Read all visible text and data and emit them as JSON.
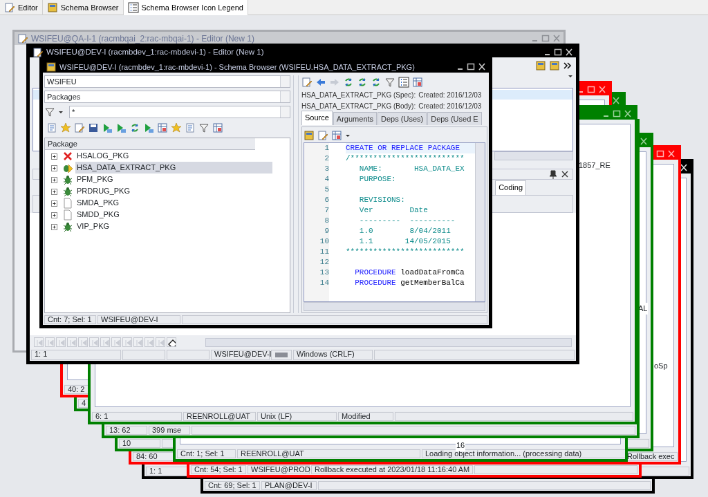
{
  "doc_tabs": [
    {
      "label": "Editor",
      "selected": false
    },
    {
      "label": "Schema Browser",
      "selected": false
    },
    {
      "label": "Schema Browser Icon Legend",
      "selected": true
    }
  ],
  "back_windows": [
    {
      "color": "#000000",
      "status": [
        "Cnt: 69; Sel: 1",
        "PLAN@DEV-I"
      ]
    },
    {
      "color": "#000000",
      "status": [
        "1:  1"
      ]
    },
    {
      "color": "#ff0000",
      "status": [
        "Cnt: 54; Sel: 1",
        "WSIFEU@PROD",
        "Rollback executed at 2023/01/18 11:16:40 AM"
      ]
    },
    {
      "color": "#ff0000",
      "status": [
        "84: 60",
        "Rollback exec"
      ],
      "fragments": [
        "oSp"
      ]
    },
    {
      "color": "#008000",
      "status": [
        "10"
      ],
      "fragments": [
        "AL"
      ]
    },
    {
      "color": "#008000",
      "status": [
        "Cnt: 1; Sel: 1",
        "REENROLL@UAT",
        "Loading object information... (processing data)"
      ],
      "fragments": [
        "16"
      ]
    },
    {
      "color": "#008000",
      "status": [
        "13: 62",
        "399 mse"
      ]
    },
    {
      "color": "#ff0000",
      "status": [
        "40: 2"
      ]
    },
    {
      "color": "#008000",
      "status": [
        "4"
      ]
    },
    {
      "color": "#008000",
      "status": [
        "6:  1",
        "REENROLL@UAT",
        "Unix (LF)",
        "Modified"
      ],
      "fragments": [
        "1857_RE"
      ]
    }
  ],
  "qa_editor": {
    "title": "WSIFEU@QA-I-1 (racmbqai_2:rac-mbqai-1) - Editor (New 1)"
  },
  "dev_editor": {
    "title": "WSIFEU@DEV-I (racmbdev_1:rac-mbdevi-1) - Editor (New 1)",
    "tab": "Coding",
    "status": [
      "1:  1",
      "WSIFEU@DEV-I",
      "Windows (CRLF)"
    ]
  },
  "schema_browser": {
    "title": "WSIFEU@DEV-I (racmbdev_1:rac-mbdevi-1) - Schema Browser (WSIFEU.HSA_DATA_EXTRACT_PKG)",
    "schema": "WSIFEU",
    "object_type": "Packages",
    "filter": "*",
    "tree_header": "Package",
    "packages": [
      {
        "name": "HSALOG_PKG",
        "kind": "invalid",
        "selected": false
      },
      {
        "name": "HSA_DATA_EXTRACT_PKG",
        "kind": "debug",
        "selected": true
      },
      {
        "name": "PFM_PKG",
        "kind": "bug",
        "selected": false
      },
      {
        "name": "PRDRUG_PKG",
        "kind": "bug",
        "selected": false
      },
      {
        "name": "SMDA_PKG",
        "kind": "plain",
        "selected": false
      },
      {
        "name": "SMDD_PKG",
        "kind": "plain",
        "selected": false
      },
      {
        "name": "VIP_PKG",
        "kind": "bug",
        "selected": false
      }
    ],
    "status": [
      "Cnt: 7; Sel: 1",
      "WSIFEU@DEV-I"
    ],
    "info": [
      {
        "object": "HSA_DATA_EXTRACT_PKG (Spec):",
        "created": "Created: 2016/12/03"
      },
      {
        "object": "HSA_DATA_EXTRACT_PKG (Body):",
        "created": "Created: 2016/12/03"
      }
    ],
    "tabs": [
      {
        "label": "Source",
        "selected": true
      },
      {
        "label": "Arguments",
        "selected": false
      },
      {
        "label": "Deps (Uses)",
        "selected": false
      },
      {
        "label": "Deps (Used E",
        "selected": false
      }
    ],
    "code": [
      {
        "no": "1",
        "segments": [
          {
            "text": "CREATE OR REPLACE PACKAGE",
            "kind": "keyword"
          }
        ]
      },
      {
        "no": "2",
        "segments": [
          {
            "text": "/*************************",
            "kind": "comment"
          }
        ]
      },
      {
        "no": "3",
        "segments": [
          {
            "text": "   NAME:       HSA_DATA_EX",
            "kind": "comment"
          }
        ]
      },
      {
        "no": "4",
        "segments": [
          {
            "text": "   PURPOSE:",
            "kind": "comment"
          }
        ]
      },
      {
        "no": "5"
      },
      {
        "no": "6",
        "segments": [
          {
            "text": "   REVISIONS:",
            "kind": "comment"
          }
        ]
      },
      {
        "no": "7",
        "segments": [
          {
            "text": "   Ver        Date",
            "kind": "comment"
          }
        ]
      },
      {
        "no": "8",
        "segments": [
          {
            "text": "   ---------  ----------",
            "kind": "comment"
          }
        ]
      },
      {
        "no": "9",
        "segments": [
          {
            "text": "   1.0        8/04/2011",
            "kind": "comment"
          }
        ]
      },
      {
        "no": "10",
        "segments": [
          {
            "text": "   1.1       14/05/2015",
            "kind": "comment"
          }
        ]
      },
      {
        "no": "11",
        "segments": [
          {
            "text": "**************************",
            "kind": "comment"
          }
        ]
      },
      {
        "no": "12"
      },
      {
        "no": "13",
        "segments": [
          {
            "text": "  PROCEDURE",
            "kind": "keyword"
          },
          {
            "text": " loadDataFromCa",
            "kind": "plain"
          }
        ]
      },
      {
        "no": "14",
        "segments": [
          {
            "text": "  PROCEDURE",
            "kind": "keyword"
          },
          {
            "text": " getMemberBalCa",
            "kind": "plain"
          }
        ]
      }
    ]
  }
}
